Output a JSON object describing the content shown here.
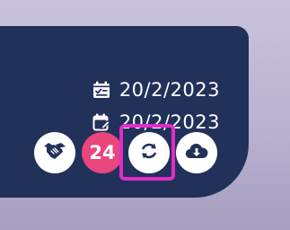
{
  "card": {
    "completed_date": "20/2/2023",
    "due_date": "20/2/2023",
    "count_badge": "24"
  },
  "icons": {
    "completed_date": "calendar-check-icon",
    "due_date": "calendar-edit-icon",
    "handshake": "handshake-icon",
    "sync": "sync-icon",
    "download": "cloud-download-icon"
  },
  "colors": {
    "card_background": "#22315a",
    "badge": "#e8467c",
    "highlight": "#e22cc8"
  }
}
